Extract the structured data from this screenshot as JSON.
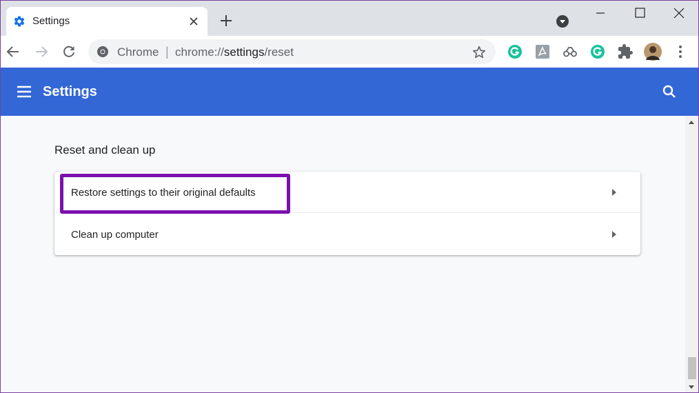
{
  "tab": {
    "title": "Settings"
  },
  "omnibox": {
    "chip": "Chrome",
    "separator": "|",
    "url_scheme": "chrome://",
    "url_path": "settings",
    "url_rest": "/reset"
  },
  "header": {
    "title": "Settings"
  },
  "section": {
    "title": "Reset and clean up",
    "items": [
      {
        "label": "Restore settings to their original defaults"
      },
      {
        "label": "Clean up computer"
      }
    ]
  },
  "colors": {
    "header_bg": "#3367d6",
    "highlight": "#7a10ad",
    "grammarly": "#15c39a"
  },
  "icons": [
    "gear-icon",
    "close-icon",
    "plus-icon",
    "minimize-icon",
    "maximize-icon",
    "back-icon",
    "forward-icon",
    "reload-icon",
    "star-icon",
    "grammarly-icon",
    "pdf-icon",
    "extension-icon",
    "puzzle-icon",
    "avatar",
    "kebab-menu-icon",
    "hamburger-icon",
    "search-icon",
    "chevron-right-icon"
  ]
}
